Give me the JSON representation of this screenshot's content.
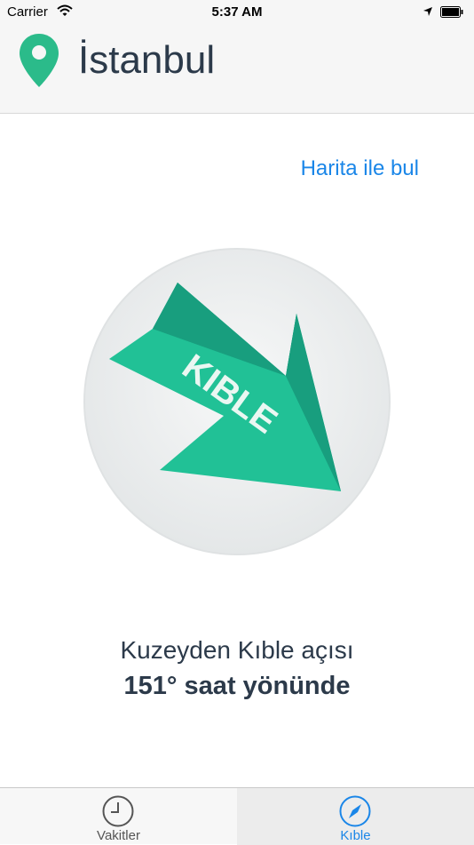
{
  "status_bar": {
    "carrier": "Carrier",
    "time": "5:37 AM"
  },
  "header": {
    "city": "İstanbul",
    "pin_icon": "location-pin-icon",
    "pin_color": "#2bbb8a"
  },
  "map_link": "Harita ile bul",
  "compass": {
    "arrow_text": "KIBLE",
    "arrow_color": "#21c196",
    "arrow_dark_color": "#189e7e"
  },
  "caption": "Kuzeyden Kıble açısı",
  "angle": "151° saat yönünde",
  "tabbar": {
    "tabs": [
      {
        "label": "Vakitler",
        "icon": "clock-icon",
        "selected": false
      },
      {
        "label": "Kıble",
        "icon": "compass-icon",
        "selected": true
      }
    ],
    "accent": "#1a86e8"
  }
}
